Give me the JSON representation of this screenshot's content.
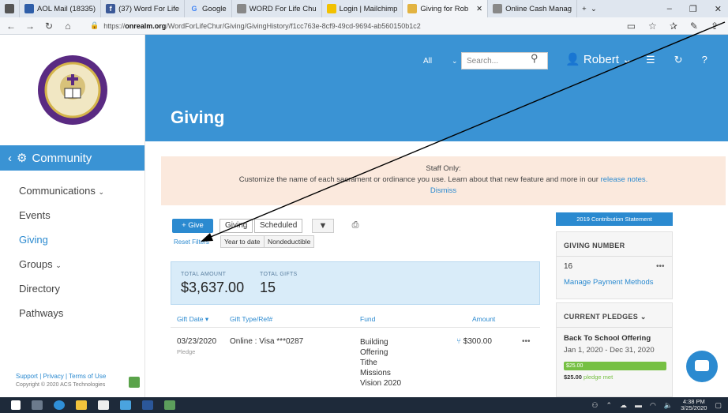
{
  "browser": {
    "tabs": [
      {
        "label": "AOL Mail (18335)",
        "color": "#2f5ea8"
      },
      {
        "label": "(37) Word For Life",
        "color": "#3b5998"
      },
      {
        "label": "Google",
        "color": "#4285f4"
      },
      {
        "label": "WORD For Life Chu",
        "color": "#888888"
      },
      {
        "label": "Login | Mailchimp",
        "color": "#f2c100"
      },
      {
        "label": "Giving for Rob",
        "color": "#e2b341"
      },
      {
        "label": "Online Cash Manag",
        "color": "#888888"
      }
    ],
    "active_tab": 5,
    "url_prefix": "https://",
    "url_domain": "onrealm.org",
    "url_path": "/WordForLifeChur/Giving/GivingHistory/f1cc763e-8cf9-49cd-9694-ab560150b1c2"
  },
  "sidebar": {
    "section": "Community",
    "items": [
      "Communications",
      "Events",
      "Giving",
      "Groups",
      "Directory",
      "Pathways"
    ],
    "footer_links": "Support | Privacy | Terms of Use",
    "copyright": "Copyright © 2020 ACS Technologies"
  },
  "header": {
    "title": "Giving",
    "filter": "All",
    "search_placeholder": "Search...",
    "user": "Robert"
  },
  "notice": {
    "title": "Staff Only:",
    "text": "Customize the name of each sacrament or ordinance you use. Learn about that new feature and more in our",
    "link": "release notes.",
    "dismiss": "Dismiss"
  },
  "toolbar": {
    "give": "+ Give",
    "giving": "Giving",
    "scheduled": "Scheduled",
    "reset": "Reset Filters",
    "chips": [
      "Year to date",
      "Nondeductible"
    ]
  },
  "totals": {
    "amount_label": "TOTAL AMOUNT",
    "amount": "$3,637.00",
    "gifts_label": "TOTAL GIFTS",
    "gifts": "15"
  },
  "table": {
    "headers": [
      "Gift Date",
      "Gift Type/Ref#",
      "Fund",
      "Amount"
    ],
    "rows": [
      {
        "date": "03/23/2020",
        "note": "Pledge",
        "type": "Online : Visa ***0287",
        "funds": [
          "Building",
          "Offering",
          "Tithe",
          "Missions",
          "Vision 2020"
        ],
        "amount": "$300.00"
      }
    ]
  },
  "right_panel": {
    "statement": "2019 Contribution Statement",
    "giving_number_label": "GIVING NUMBER",
    "giving_number": "16",
    "manage": "Manage Payment Methods",
    "pledges_label": "CURRENT PLEDGES",
    "pledge_name": "Back To School Offering",
    "pledge_range": "Jan 1, 2020 - Dec 31, 2020",
    "pledge_bar_label": "$25.00",
    "pledge_progress": 1.0,
    "pledge_paid": "$25.00",
    "pledge_status": "pledge met"
  },
  "taskbar": {
    "time": "4:38 PM",
    "date": "3/25/2020"
  },
  "colors": {
    "brand": "#3a93d4",
    "link": "#2b8ad0",
    "notice_bg": "#fbe9dd",
    "progress": "#76c043"
  }
}
